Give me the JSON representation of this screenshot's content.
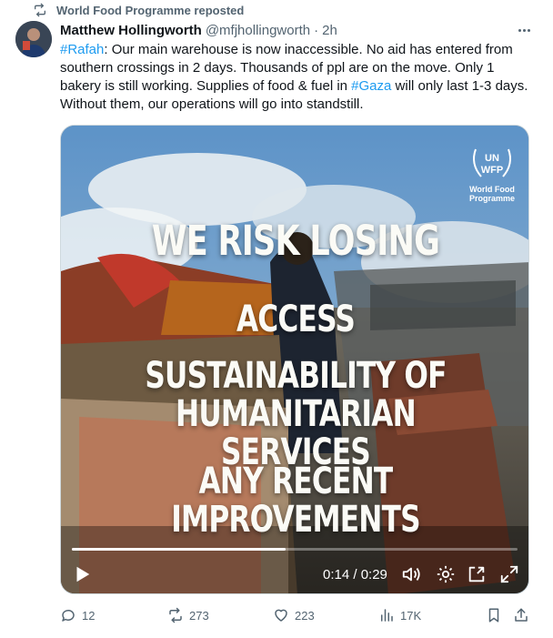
{
  "repost": {
    "label": "World Food Programme reposted",
    "icon": "repost-icon"
  },
  "author": {
    "name": "Matthew Hollingworth",
    "handle": "@mfjhollingworth",
    "separator": "·",
    "time": "2h",
    "avatar_icon": "avatar"
  },
  "tweet": {
    "segments": [
      {
        "text": "#Rafah",
        "tag": true
      },
      {
        "text": ": Our main warehouse is now inaccessible. No aid has entered from southern crossings in 2 days. Thousands of ppl are on the move. Only 1 bakery is still working. Supplies of food & fuel in ",
        "tag": false
      },
      {
        "text": "#Gaza",
        "tag": true
      },
      {
        "text": " will only last 1-3 days. Without them, our operations will go into standstill.",
        "tag": false
      }
    ]
  },
  "video": {
    "logo": {
      "line1": "UN",
      "line2": "WFP",
      "org": "World Food Programme"
    },
    "overlay": {
      "line1": "WE RISK LOSING",
      "line2": "ACCESS",
      "line3": "SUSTAINABILITY OF",
      "line4": "HUMANITARIAN SERVICES",
      "line5": "ANY RECENT",
      "line6": "IMPROVEMENTS"
    },
    "time_readout": "0:14 / 0:29",
    "progress": 0.48
  },
  "actions": {
    "replies": "12",
    "reposts": "273",
    "likes": "223",
    "views": "17K"
  },
  "colors": {
    "link": "#1d9bf0",
    "secondary_text": "#536471",
    "primary_text": "#0f1419"
  }
}
